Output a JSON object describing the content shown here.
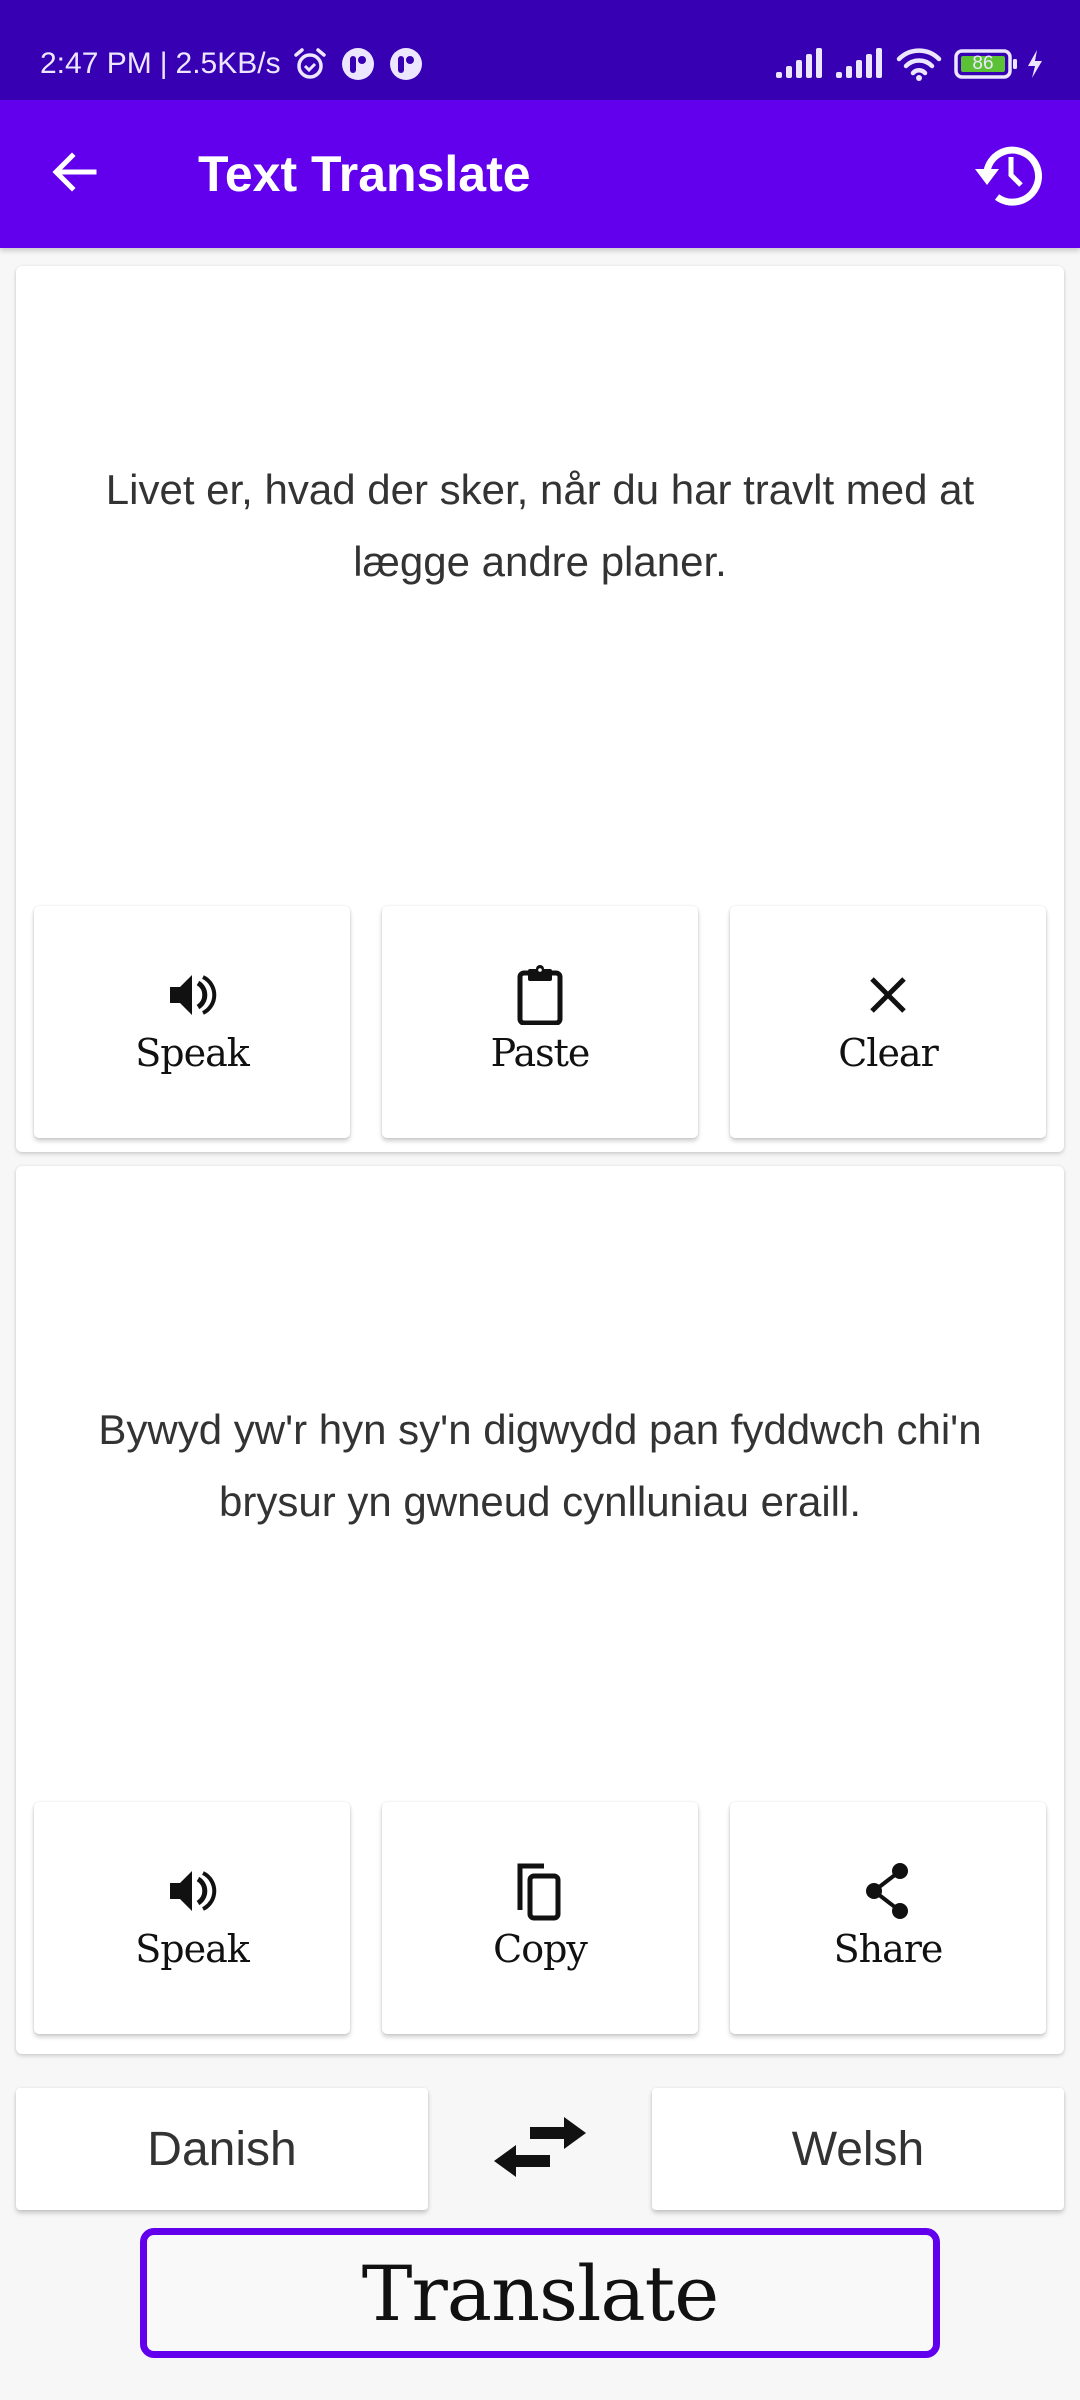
{
  "status_bar": {
    "time": "2:47 PM",
    "separator": "|",
    "network_speed": "2.5KB/s",
    "left_icons": [
      "alarm-icon",
      "app-notification-icon",
      "app-notification-icon"
    ],
    "right_icons": [
      "signal-icon",
      "signal-icon",
      "wifi-icon",
      "battery-icon",
      "charging-icon"
    ],
    "battery_level": "86",
    "colors": {
      "background": "#3700B3",
      "battery_fill": "#5bc236"
    }
  },
  "app_bar": {
    "title": "Text Translate",
    "back_icon": "arrow-back-icon",
    "history_icon": "history-icon",
    "color": "#6200EE"
  },
  "source_card": {
    "text": "Livet er, hvad der sker, når du har travlt med at lægge andre planer.",
    "actions": [
      {
        "label": "Speak",
        "icon": "volume-icon"
      },
      {
        "label": "Paste",
        "icon": "clipboard-icon"
      },
      {
        "label": "Clear",
        "icon": "close-icon"
      }
    ]
  },
  "result_card": {
    "text": "Bywyd yw'r hyn sy'n digwydd pan fyddwch chi'n brysur yn gwneud cynlluniau eraill.",
    "actions": [
      {
        "label": "Speak",
        "icon": "volume-icon"
      },
      {
        "label": "Copy",
        "icon": "copy-icon"
      },
      {
        "label": "Share",
        "icon": "share-icon"
      }
    ]
  },
  "languages": {
    "source": "Danish",
    "target": "Welsh",
    "swap_icon": "swap-arrows-icon"
  },
  "translate_button": {
    "label": "Translate",
    "border_color": "#6200EE"
  }
}
